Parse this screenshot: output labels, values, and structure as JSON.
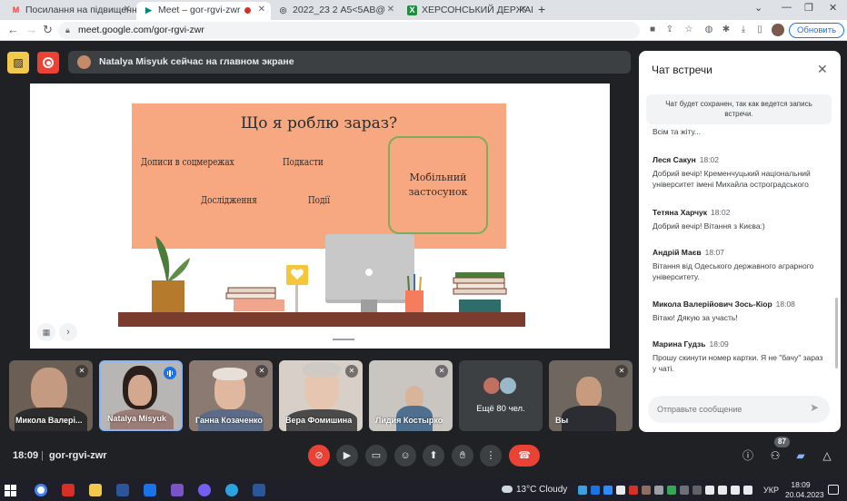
{
  "browser": {
    "tabs": [
      {
        "label": "Посилання на підвищення ква...",
        "fav": "M",
        "favColor": "#ea4335",
        "active": false
      },
      {
        "label": "Meet – gor-rgvi-zwr",
        "fav": "▶",
        "favColor": "#00897b",
        "active": true,
        "recording": true
      },
      {
        "label": "2022_23 2 А5<5АВ@",
        "fav": "◎",
        "favColor": "#5f6368",
        "active": false
      },
      {
        "label": "ХЕРСОНСЬКИЙ ДЕРЖАВНИЙ А...",
        "fav": "X",
        "favColor": "#1e8e3e",
        "active": false
      }
    ],
    "new_tab": "+",
    "url": "meet.google.com/gor-rgvi-zwr",
    "update_button": "Обновить"
  },
  "banner": {
    "presenter_text": "Natalya Misyuk сейчас на главном экране"
  },
  "slide": {
    "title": "Що я роблю зараз?",
    "items": [
      "Дописи в соцмережах",
      "Подкасти",
      "Дослідження",
      "Події"
    ],
    "box_text": "Мобільний застосунок"
  },
  "participants": [
    {
      "name": "Микола Валері...",
      "muted": true
    },
    {
      "name": "Natalya Misyuk",
      "muted": false,
      "speaking": true
    },
    {
      "name": "Ганна Козаченко",
      "muted": true
    },
    {
      "name": "Вера Фомишина",
      "muted": true
    },
    {
      "name": "Лидия Костырко",
      "muted": true
    },
    {
      "name": "Ещё 80 чел.",
      "more": true
    },
    {
      "name": "Вы",
      "muted": true
    }
  ],
  "bottom": {
    "time": "18:09",
    "separator": "|",
    "code": "gor-rgvi-zwr",
    "participants_count": "87"
  },
  "chat": {
    "title": "Чат встречи",
    "notice": "Чат будет сохранен, так как ведется запись встречи.",
    "clipped_text": "Всім та жіту...",
    "messages": [
      {
        "author": "Леся Сакун",
        "time": "18:02",
        "text": "Добрий вечір! Кременчуцький національний університет імені Михайла остроградського"
      },
      {
        "author": "Тетяна Харчук",
        "time": "18:02",
        "text": "Добрий вечір! Вітання з Києва:)"
      },
      {
        "author": "Андрій Маєв",
        "time": "18:07",
        "text": "Вітання від Одеського державного аграрного університету."
      },
      {
        "author": "Микола Валерійович Зось-Кіор",
        "time": "18:08",
        "text": "Вітаю! Дякую за участь!"
      },
      {
        "author": "Марина Гудзь",
        "time": "18:09",
        "text": "Прошу скинути номер картки. Я не \"бачу\" зараз у чаті."
      }
    ],
    "input_placeholder": "Отправьте сообщение"
  },
  "taskbar": {
    "weather": "13°C Cloudy",
    "lang": "УКР",
    "clock_time": "18:09",
    "clock_date": "20.04.2023"
  }
}
